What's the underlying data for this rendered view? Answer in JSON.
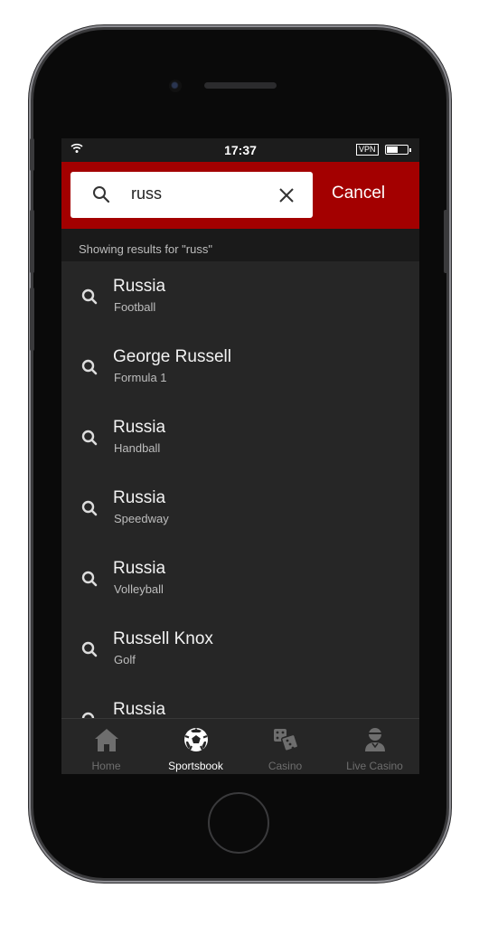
{
  "status_bar": {
    "time": "17:37",
    "vpn": "VPN",
    "battery_level": 0.55
  },
  "search": {
    "query": "russ",
    "cancel_label": "Cancel"
  },
  "results_header": "Showing results for \"russ\"",
  "results": [
    {
      "title": "Russia",
      "subtitle": "Football"
    },
    {
      "title": "George Russell",
      "subtitle": "Formula 1"
    },
    {
      "title": "Russia",
      "subtitle": "Handball"
    },
    {
      "title": "Russia",
      "subtitle": "Speedway"
    },
    {
      "title": "Russia",
      "subtitle": "Volleyball"
    },
    {
      "title": "Russell Knox",
      "subtitle": "Golf"
    },
    {
      "title": "Russia",
      "subtitle": ""
    }
  ],
  "tabs": [
    {
      "label": "Home",
      "icon": "home-icon",
      "active": false
    },
    {
      "label": "Sportsbook",
      "icon": "soccer-ball-icon",
      "active": true
    },
    {
      "label": "Casino",
      "icon": "dice-icon",
      "active": false
    },
    {
      "label": "Live Casino",
      "icon": "dealer-icon",
      "active": false
    }
  ],
  "colors": {
    "accent": "#a30000",
    "background": "#262626",
    "inactive_tab": "#6e6e6e"
  }
}
